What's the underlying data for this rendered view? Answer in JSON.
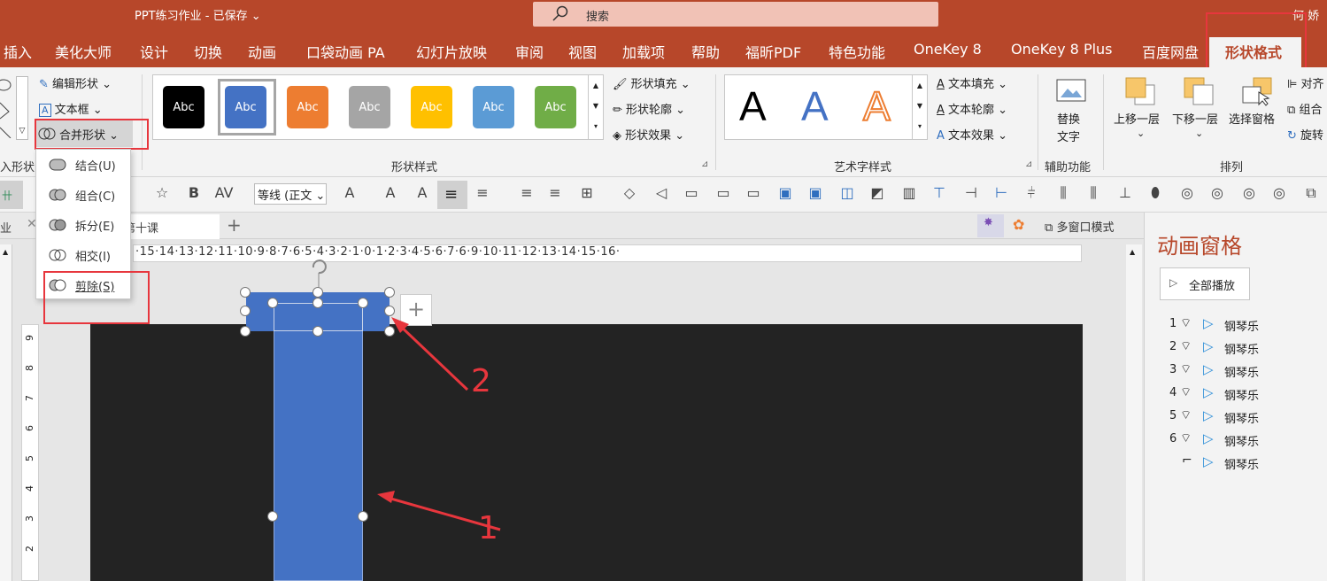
{
  "titlebar": {
    "doc_title": "PPT练习作业  -  已保存  ⌄",
    "search_text": "搜索",
    "user": "何 娇"
  },
  "tabs": [
    "插入",
    "美化大师",
    "设计",
    "切换",
    "动画",
    "口袋动画 PA",
    "幻灯片放映",
    "审阅",
    "视图",
    "加载项",
    "帮助",
    "福昕PDF",
    "特色功能",
    "OneKey 8",
    "OneKey 8 Plus",
    "百度网盘",
    "形状格式"
  ],
  "insert_shapes": {
    "edit_shape": "编辑形状 ⌄",
    "textbox": "文本框  ⌄",
    "merge_shapes": "合并形状 ⌄",
    "group_label": "入形状"
  },
  "shape_styles": {
    "swatch_label": "Abc",
    "colors": [
      "#000000",
      "#4472c4",
      "#ed7d31",
      "#a5a5a5",
      "#ffc000",
      "#5b9bd5",
      "#70ad47"
    ],
    "fill": "形状填充 ⌄",
    "outline": "形状轮廓 ⌄",
    "effects": "形状效果 ⌄",
    "group_label": "形状样式"
  },
  "wordart": {
    "letter": "A",
    "fill": "文本填充 ⌄",
    "outline": "文本轮廓 ⌄",
    "effects": "文本效果 ⌄",
    "group_label": "艺术字样式"
  },
  "accessibility": {
    "alt_text_line1": "替换",
    "alt_text_line2": "文字",
    "group_label": "辅助功能"
  },
  "arrange": {
    "bring_forward": "上移一层",
    "send_backward": "下移一层",
    "selection_pane": "选择窗格",
    "align": "对齐",
    "group": "组合",
    "rotate": "旋转",
    "group_label": "排列"
  },
  "format_bar": {
    "font_name": "等线 (正文 ⌄"
  },
  "tabstrip": {
    "tab1": "业",
    "tab2": "第十课",
    "multiwindow": "多窗口模式"
  },
  "ruler": {
    "ticks": "·15·14·13·12·11·10·9·8·7·6·5·4·3·2·1·0·1·2·3·4·5·6·7·6·9·10·11·12·13·14·15·16·"
  },
  "vruler": {
    "ticks": [
      "9",
      "8",
      "7",
      "6",
      "5",
      "4",
      "3",
      "2"
    ]
  },
  "merge_menu": {
    "items": [
      "结合(U)",
      "组合(C)",
      "拆分(E)",
      "相交(I)",
      "剪除(S)"
    ]
  },
  "anim_pane": {
    "title": "动画窗格",
    "play_all": "全部播放",
    "items": [
      {
        "num": "1",
        "name": "钢琴乐"
      },
      {
        "num": "2",
        "name": "钢琴乐"
      },
      {
        "num": "3",
        "name": "钢琴乐"
      },
      {
        "num": "4",
        "name": "钢琴乐"
      },
      {
        "num": "5",
        "name": "钢琴乐"
      },
      {
        "num": "6",
        "name": "钢琴乐"
      },
      {
        "num": "",
        "name": "钢琴乐"
      }
    ]
  },
  "annotations": {
    "label1": "1",
    "label2": "2"
  },
  "colors": {
    "accent": "#b7472a",
    "shape_blue": "#4472c4",
    "annotation_red": "#e7363d"
  }
}
